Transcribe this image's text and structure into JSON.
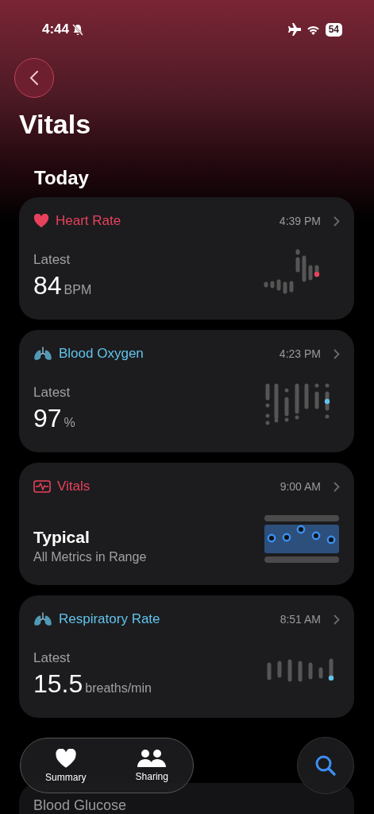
{
  "status_bar": {
    "time": "4:44",
    "battery": "54"
  },
  "title": "Vitals",
  "section": "Today",
  "cards": [
    {
      "kind": "pulse",
      "title": "Heart Rate",
      "color": "#e8415c",
      "time": "4:39 PM",
      "label": "Latest",
      "value": "84",
      "unit": "BPM"
    },
    {
      "kind": "oxygen",
      "title": "Blood Oxygen",
      "color": "#62c3ec",
      "time": "4:23 PM",
      "label": "Latest",
      "value": "97",
      "unit": "%"
    },
    {
      "kind": "range",
      "title": "Vitals",
      "color": "#e8415c",
      "time": "9:00 AM",
      "status": "Typical",
      "detail": "All Metrics in Range"
    },
    {
      "kind": "breath",
      "title": "Respiratory Rate",
      "color": "#62c3ec",
      "time": "8:51 AM",
      "label": "Latest",
      "value": "15.5",
      "unit": "breaths/min"
    }
  ],
  "empty_cards": [
    {
      "title": "Blood Glucose"
    }
  ],
  "tab_bar": [
    {
      "label": "Summary",
      "kind": "heart"
    },
    {
      "label": "Sharing",
      "kind": "people"
    }
  ]
}
